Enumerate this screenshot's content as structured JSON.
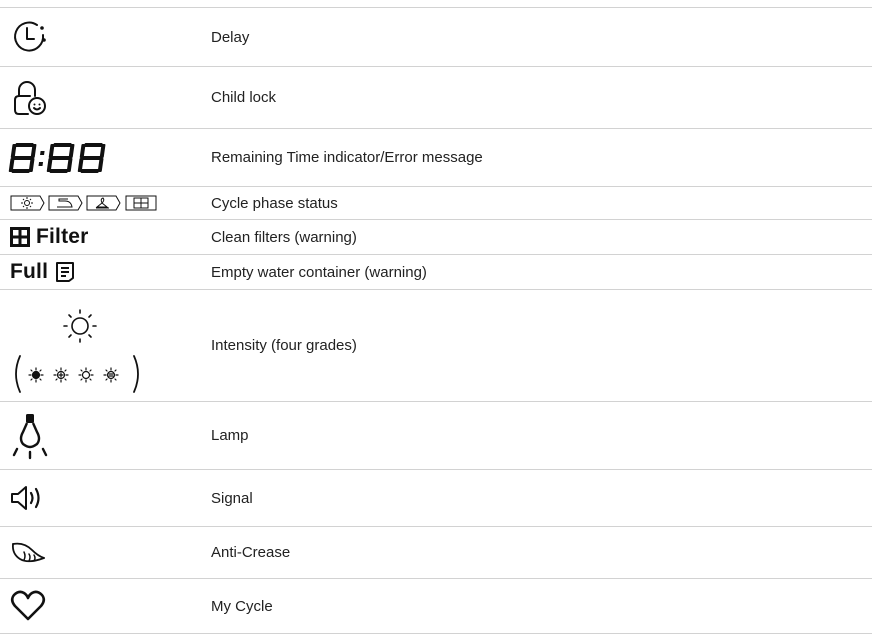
{
  "rows": [
    {
      "icon": "clock-delay-icon",
      "label": "Delay"
    },
    {
      "icon": "child-lock-icon",
      "label": "Child lock"
    },
    {
      "icon": "seven-segment-display-icon",
      "label": "Remaining Time indicator/Error message"
    },
    {
      "icon": "cycle-phase-icons",
      "label": "Cycle phase status"
    },
    {
      "icon": "filter-grid-icon",
      "symbol_text": "Filter",
      "label": "Clean filters (warning)"
    },
    {
      "icon": "water-container-icon",
      "symbol_text": "Full",
      "label": "Empty water container (warning)"
    },
    {
      "icon": "intensity-sun-icon",
      "label": "Intensity (four grades)"
    },
    {
      "icon": "lamp-icon",
      "label": "Lamp"
    },
    {
      "icon": "speaker-signal-icon",
      "label": "Signal"
    },
    {
      "icon": "feather-icon",
      "label": "Anti-Crease"
    },
    {
      "icon": "heart-icon",
      "label": "My Cycle"
    }
  ]
}
